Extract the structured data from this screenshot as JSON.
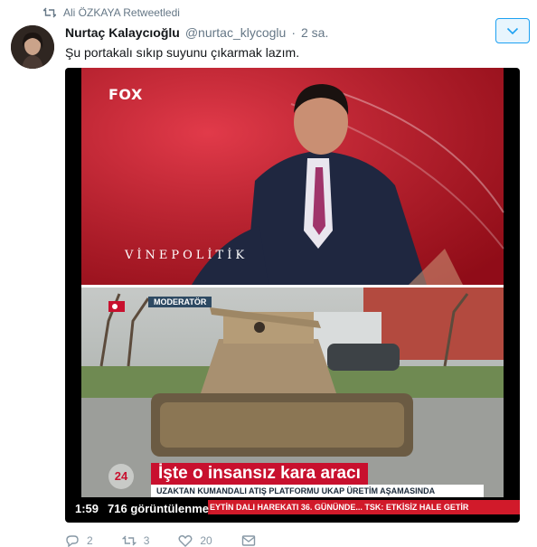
{
  "retweet_banner": {
    "icon": "retweet-icon",
    "text": "Ali ÖZKAYA Retweetledi"
  },
  "tweet": {
    "author_name": "Nurtaç Kalaycıoğlu",
    "author_handle": "@nurtac_klycoglu",
    "separator": "·",
    "time": "2 sa.",
    "text": "Şu portakalı sıkıp suyunu çıkarmak lazım.",
    "menu_icon": "chevron-down-icon"
  },
  "media": {
    "channel_logo": "FOX",
    "watermark": "VİNEPOLİTİK",
    "moderator_tag": "MODERATÖR",
    "headline": "İşte o insansız kara aracı",
    "subline": "UZAKTAN KUMANDALI ATIŞ PLATFORMU UKAP ÜRETİM AŞAMASINDA",
    "ticker": "EYTİN DALI HAREKATI 36. GÜNÜNDE... TSK: ETKİSİZ HALE GETİR",
    "badge": "24",
    "duration": "1:59",
    "views": "716 görüntülenme"
  },
  "actions": [
    {
      "icon": "reply-icon",
      "count": "2"
    },
    {
      "icon": "retweet-icon",
      "count": "3"
    },
    {
      "icon": "heart-icon",
      "count": "20"
    },
    {
      "icon": "message-icon",
      "count": ""
    }
  ],
  "colors": {
    "accent": "#1da1f2",
    "muted": "#657786",
    "news_red": "#c8102e"
  }
}
